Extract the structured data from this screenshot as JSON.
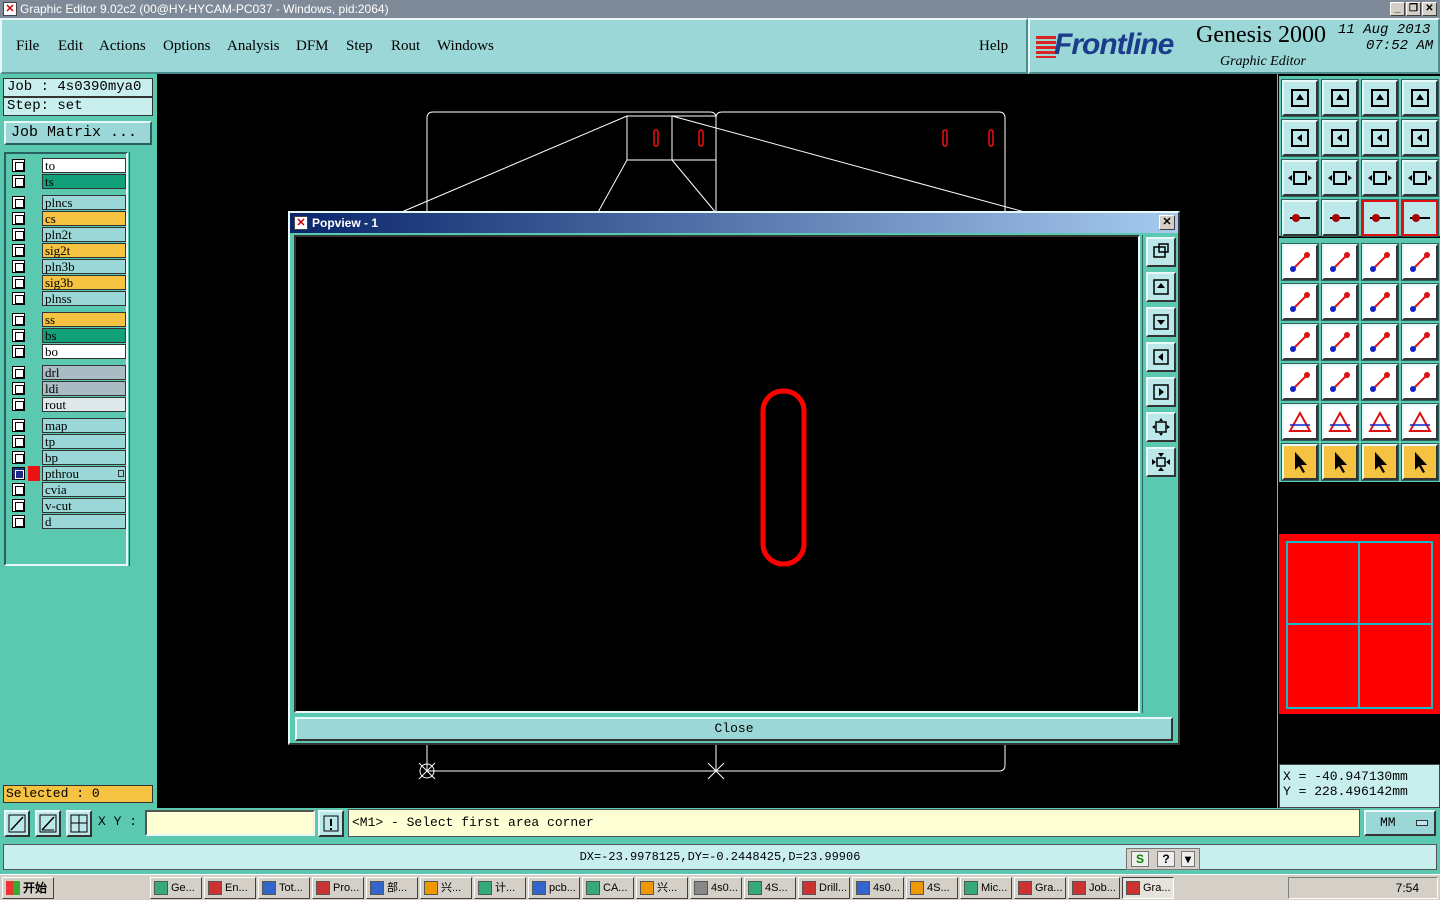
{
  "window": {
    "title": "Graphic Editor 9.02c2 (00@HY-HYCAM-PC037 - Windows, pid:2064)"
  },
  "menu": {
    "items": [
      "File",
      "Edit",
      "Actions",
      "Options",
      "Analysis",
      "DFM",
      "Step",
      "Rout",
      "Windows"
    ],
    "help": "Help"
  },
  "brand": {
    "logo": "Frontline",
    "product": "Genesis 2000",
    "subtitle": "Graphic Editor",
    "date": "11 Aug 2013",
    "time": "07:52 AM"
  },
  "job": {
    "job_line": "Job : 4s0390mya0",
    "step_line": "Step: set",
    "matrix_button": "Job Matrix ..."
  },
  "layers": [
    {
      "name": "to",
      "color": "#ffffff"
    },
    {
      "name": "ts",
      "color": "#12a07a"
    },
    {
      "name": "plncs",
      "color": "#9ad7d6"
    },
    {
      "name": "cs",
      "color": "#f5c242"
    },
    {
      "name": "pln2t",
      "color": "#9ad7d6"
    },
    {
      "name": "sig2t",
      "color": "#f5c242"
    },
    {
      "name": "pln3b",
      "color": "#9ad7d6"
    },
    {
      "name": "sig3b",
      "color": "#f5c242"
    },
    {
      "name": "plnss",
      "color": "#9ad7d6"
    },
    {
      "name": "ss",
      "color": "#f5c242"
    },
    {
      "name": "bs",
      "color": "#12a07a"
    },
    {
      "name": "bo",
      "color": "#ffffff"
    },
    {
      "name": "drl",
      "color": "#a9bcc4"
    },
    {
      "name": "ldi",
      "color": "#a9bcc4"
    },
    {
      "name": "rout",
      "color": "#dfe8ea"
    },
    {
      "name": "map",
      "color": "#9ad7d6"
    },
    {
      "name": "tp",
      "color": "#9ad7d6"
    },
    {
      "name": "bp",
      "color": "#9ad7d6"
    },
    {
      "name": "pthrou",
      "color": "#9ad7d6",
      "active": true
    },
    {
      "name": "cvia",
      "color": "#9ad7d6"
    },
    {
      "name": "v-cut",
      "color": "#9ad7d6"
    },
    {
      "name": "d",
      "color": "#9ad7d6"
    }
  ],
  "selected": "Selected : 0",
  "popview": {
    "title": "Popview - 1",
    "close_label": "Close"
  },
  "coords": {
    "x": "X  =  -40.947130mm",
    "y": "Y  =  228.496142mm"
  },
  "status": {
    "xy_label": "X Y :",
    "xy_value": "",
    "prompt": "<M1> - Select first area corner",
    "units": "MM",
    "measure": "DX=-23.9978125,DY=-0.2448425,D=23.99906"
  },
  "taskbar": {
    "start": "开始",
    "tasks": [
      "Ge...",
      "En...",
      "Tot...",
      "Pro...",
      "部...",
      "兴...",
      "计...",
      "pcb...",
      "CA...",
      "兴...",
      "4s0...",
      "4S...",
      "Drill...",
      "4s0...",
      "4S...",
      "Mic...",
      "Gra...",
      "Job...",
      "Gra..."
    ],
    "clock": "7:54"
  },
  "colors": {
    "panel": "#5bc9af",
    "menu": "#9ad7d6",
    "feature": "#ff0000"
  }
}
